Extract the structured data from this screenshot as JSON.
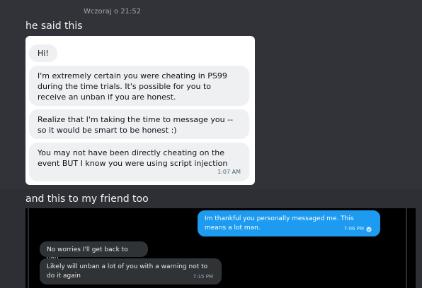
{
  "top_message": {
    "timestamp": "Wczoraj o 21:52",
    "text": "he said this"
  },
  "light_screenshot": {
    "messages": [
      {
        "text": "Hi!"
      },
      {
        "text": "I'm extremely certain you were cheating in PS99 during the time trials. It's possible for you to receive an unban if you are honest."
      },
      {
        "text": "Realize that I'm taking the time to message you -- so it would be smart to be honest :)"
      },
      {
        "text": "You may not have been directly cheating on the event BUT I know you were using script injection"
      }
    ],
    "time": "1:07 AM"
  },
  "second_message": {
    "text": "and this to my friend too"
  },
  "dark_screenshot": {
    "sent": {
      "text": "Im thankful you personally messaged me. This means a lot man.",
      "time": "7:06 PM"
    },
    "received": [
      {
        "text": "No worries I'll get back to you"
      },
      {
        "text": "Likely will unban a lot of you with a warning not to do it again",
        "time": "7:15 PM"
      }
    ],
    "colors": {
      "sent_bubble": "#1d9bf0",
      "received_bubble": "#2f3336",
      "background": "#000000"
    }
  }
}
